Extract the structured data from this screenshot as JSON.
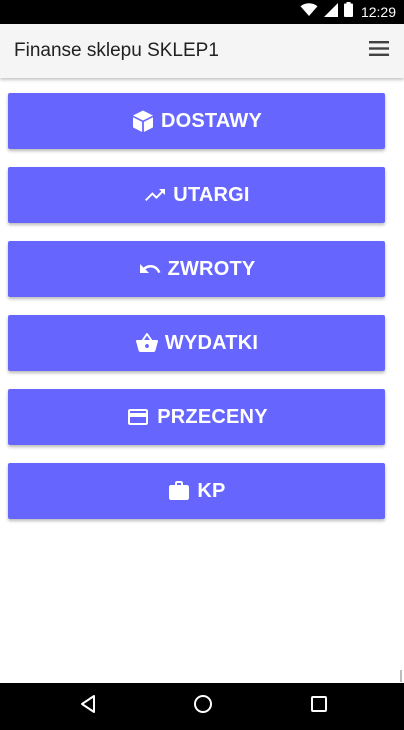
{
  "status_bar": {
    "time": "12:29",
    "icons": [
      "wifi-icon",
      "signal-icon",
      "battery-icon"
    ]
  },
  "app_bar": {
    "title": "Finanse sklepu SKLEP1",
    "menu_icon": "hamburger-menu-icon"
  },
  "menu_buttons": [
    {
      "label": "DOSTAWY",
      "icon": "box-icon"
    },
    {
      "label": "UTARGI",
      "icon": "trending-up-icon"
    },
    {
      "label": "ZWROTY",
      "icon": "undo-icon"
    },
    {
      "label": "WYDATKI",
      "icon": "shopping-basket-icon"
    },
    {
      "label": "PRZECENY",
      "icon": "credit-card-icon"
    },
    {
      "label": "KP",
      "icon": "briefcase-icon"
    }
  ],
  "nav_bar": {
    "buttons": [
      "back-icon",
      "home-icon",
      "recents-icon"
    ]
  },
  "colors": {
    "button_bg": "#6666ff",
    "app_bar_bg": "#f5f5f5",
    "system_bar_bg": "#000000"
  }
}
